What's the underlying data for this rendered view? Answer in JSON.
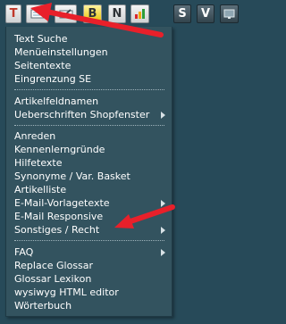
{
  "toolbar": {
    "buttons": [
      {
        "name": "text-tool",
        "label": "T"
      },
      {
        "name": "page-tool",
        "label": ""
      },
      {
        "name": "edit-tool",
        "label": ""
      },
      {
        "name": "bold-tool",
        "label": "B"
      },
      {
        "name": "n-tool",
        "label": "N"
      },
      {
        "name": "chart-tool",
        "label": ""
      },
      {
        "name": "s-tool",
        "label": "S"
      },
      {
        "name": "v-tool",
        "label": "V"
      },
      {
        "name": "monitor-tool",
        "label": ""
      }
    ]
  },
  "menu": {
    "groups": [
      {
        "items": [
          {
            "label": "Text Suche"
          },
          {
            "label": "Menüeinstellungen"
          },
          {
            "label": "Seitentexte"
          },
          {
            "label": "Eingrenzung SE"
          }
        ]
      },
      {
        "items": [
          {
            "label": "Artikelfeldnamen"
          },
          {
            "label": "Ueberschriften Shopfenster",
            "submenu": true
          }
        ]
      },
      {
        "items": [
          {
            "label": "Anreden"
          },
          {
            "label": "Kennenlerngründe"
          },
          {
            "label": "Hilfetexte"
          },
          {
            "label": "Synonyme / Var. Basket"
          },
          {
            "label": "Artikelliste"
          },
          {
            "label": "E-Mail-Vorlagetexte",
            "submenu": true
          },
          {
            "label": "E-Mail Responsive"
          },
          {
            "label": "Sonstiges / Recht",
            "submenu": true
          }
        ]
      },
      {
        "items": [
          {
            "label": "FAQ",
            "submenu": true
          },
          {
            "label": "Replace Glossar"
          },
          {
            "label": "Glossar Lexikon"
          },
          {
            "label": "wysiwyg HTML editor"
          },
          {
            "label": "Wörterbuch"
          }
        ]
      }
    ]
  },
  "colors": {
    "background": "#274a59",
    "menu_background": "#33535f",
    "annotation_red": "#e8202a"
  }
}
